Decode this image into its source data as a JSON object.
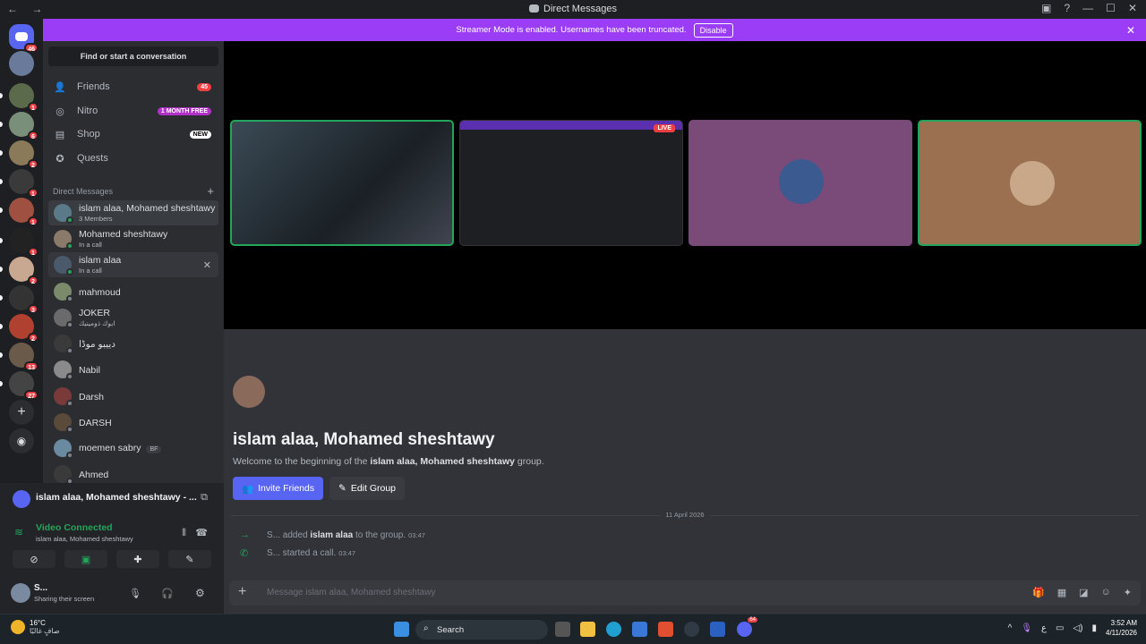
{
  "window": {
    "title": "Direct Messages",
    "nav": "← →"
  },
  "banner": {
    "text": "Streamer Mode is enabled. Usernames have been truncated.",
    "button": "Disable"
  },
  "rail": {
    "home_badge": "46",
    "servers": [
      {
        "badge": "1",
        "color": "#5a6a4a"
      },
      {
        "badge": "6",
        "color": "#7a8f7a"
      },
      {
        "badge": "2",
        "color": "#8a7a5a"
      },
      {
        "badge": "1",
        "color": "#3a3a3a"
      },
      {
        "badge": "1",
        "color": "#a05040"
      },
      {
        "badge": "1",
        "color": "#222222"
      },
      {
        "badge": "2",
        "color": "#c8a890"
      },
      {
        "badge": "3",
        "color": "#333333"
      },
      {
        "badge": "2",
        "color": "#b04030"
      },
      {
        "badge": "13",
        "color": "#6a5a4a"
      },
      {
        "badge": "27",
        "color": "#444444"
      }
    ]
  },
  "sidebar": {
    "search": "Find or start a conversation",
    "nav": [
      {
        "label": "Friends",
        "tag": "45",
        "tag_color": "#f23f43"
      },
      {
        "label": "Nitro",
        "tag": "1 MONTH FREE",
        "tag_color": "#b030c8"
      },
      {
        "label": "Shop",
        "tag": "NEW",
        "tag_color": "#ffffff"
      },
      {
        "label": "Quests",
        "tag": "",
        "tag_color": ""
      }
    ],
    "dm_header": "Direct Messages",
    "dms": [
      {
        "name": "islam alaa, Mohamed sheshtawy",
        "sub": "3 Members"
      },
      {
        "name": "Mohamed sheshtawy",
        "sub": "In a call"
      },
      {
        "name": "islam alaa",
        "sub": "In a call"
      },
      {
        "name": "mahmoud",
        "sub": ""
      },
      {
        "name": "JOKER",
        "sub": "ابوك ذومينيك"
      },
      {
        "name": "دييبو موڈا",
        "sub": ""
      },
      {
        "name": "Nabil",
        "sub": ""
      },
      {
        "name": "Darsh",
        "sub": ""
      },
      {
        "name": "DARSH",
        "sub": ""
      },
      {
        "name": "moemen sabry",
        "sub": "",
        "tag": "BF"
      },
      {
        "name": "Ahmed",
        "sub": ""
      }
    ]
  },
  "voice": {
    "channel": "islam alaa, Mohamed sheshtawy - ...",
    "status": "Video Connected",
    "sub": "islam alaa, Mohamed sheshtawy"
  },
  "user": {
    "name": "S...",
    "status": "Sharing their screen"
  },
  "call": {
    "live_label": "LIVE"
  },
  "chat": {
    "title": "islam alaa, Mohamed sheshtawy",
    "welcome_pre": "Welcome to the beginning of the ",
    "welcome_name": "islam alaa, Mohamed sheshtawy",
    "welcome_post": " group.",
    "invite": "Invite Friends",
    "edit": "Edit Group",
    "date": "11 April 2026",
    "messages": [
      {
        "actor": "S...",
        "verb": "added",
        "target": "islam alaa",
        "rest": "to the group.",
        "time": "03:47"
      },
      {
        "actor": "S...",
        "verb": "started a call.",
        "target": "",
        "rest": "",
        "time": "03:47"
      }
    ],
    "placeholder": "Message islam alaa, Mohamed sheshtawy"
  },
  "taskbar": {
    "temp": "16°C",
    "weather": "صافٍ غالبًا",
    "search": "Search",
    "lang": "ع",
    "time": "3:52 AM",
    "date": "4/11/2026",
    "discord_badge": "64"
  },
  "colors": {
    "accent": "#5865f2",
    "streamer": "#9b3cf6",
    "green": "#23a55a",
    "red": "#f23f43"
  }
}
